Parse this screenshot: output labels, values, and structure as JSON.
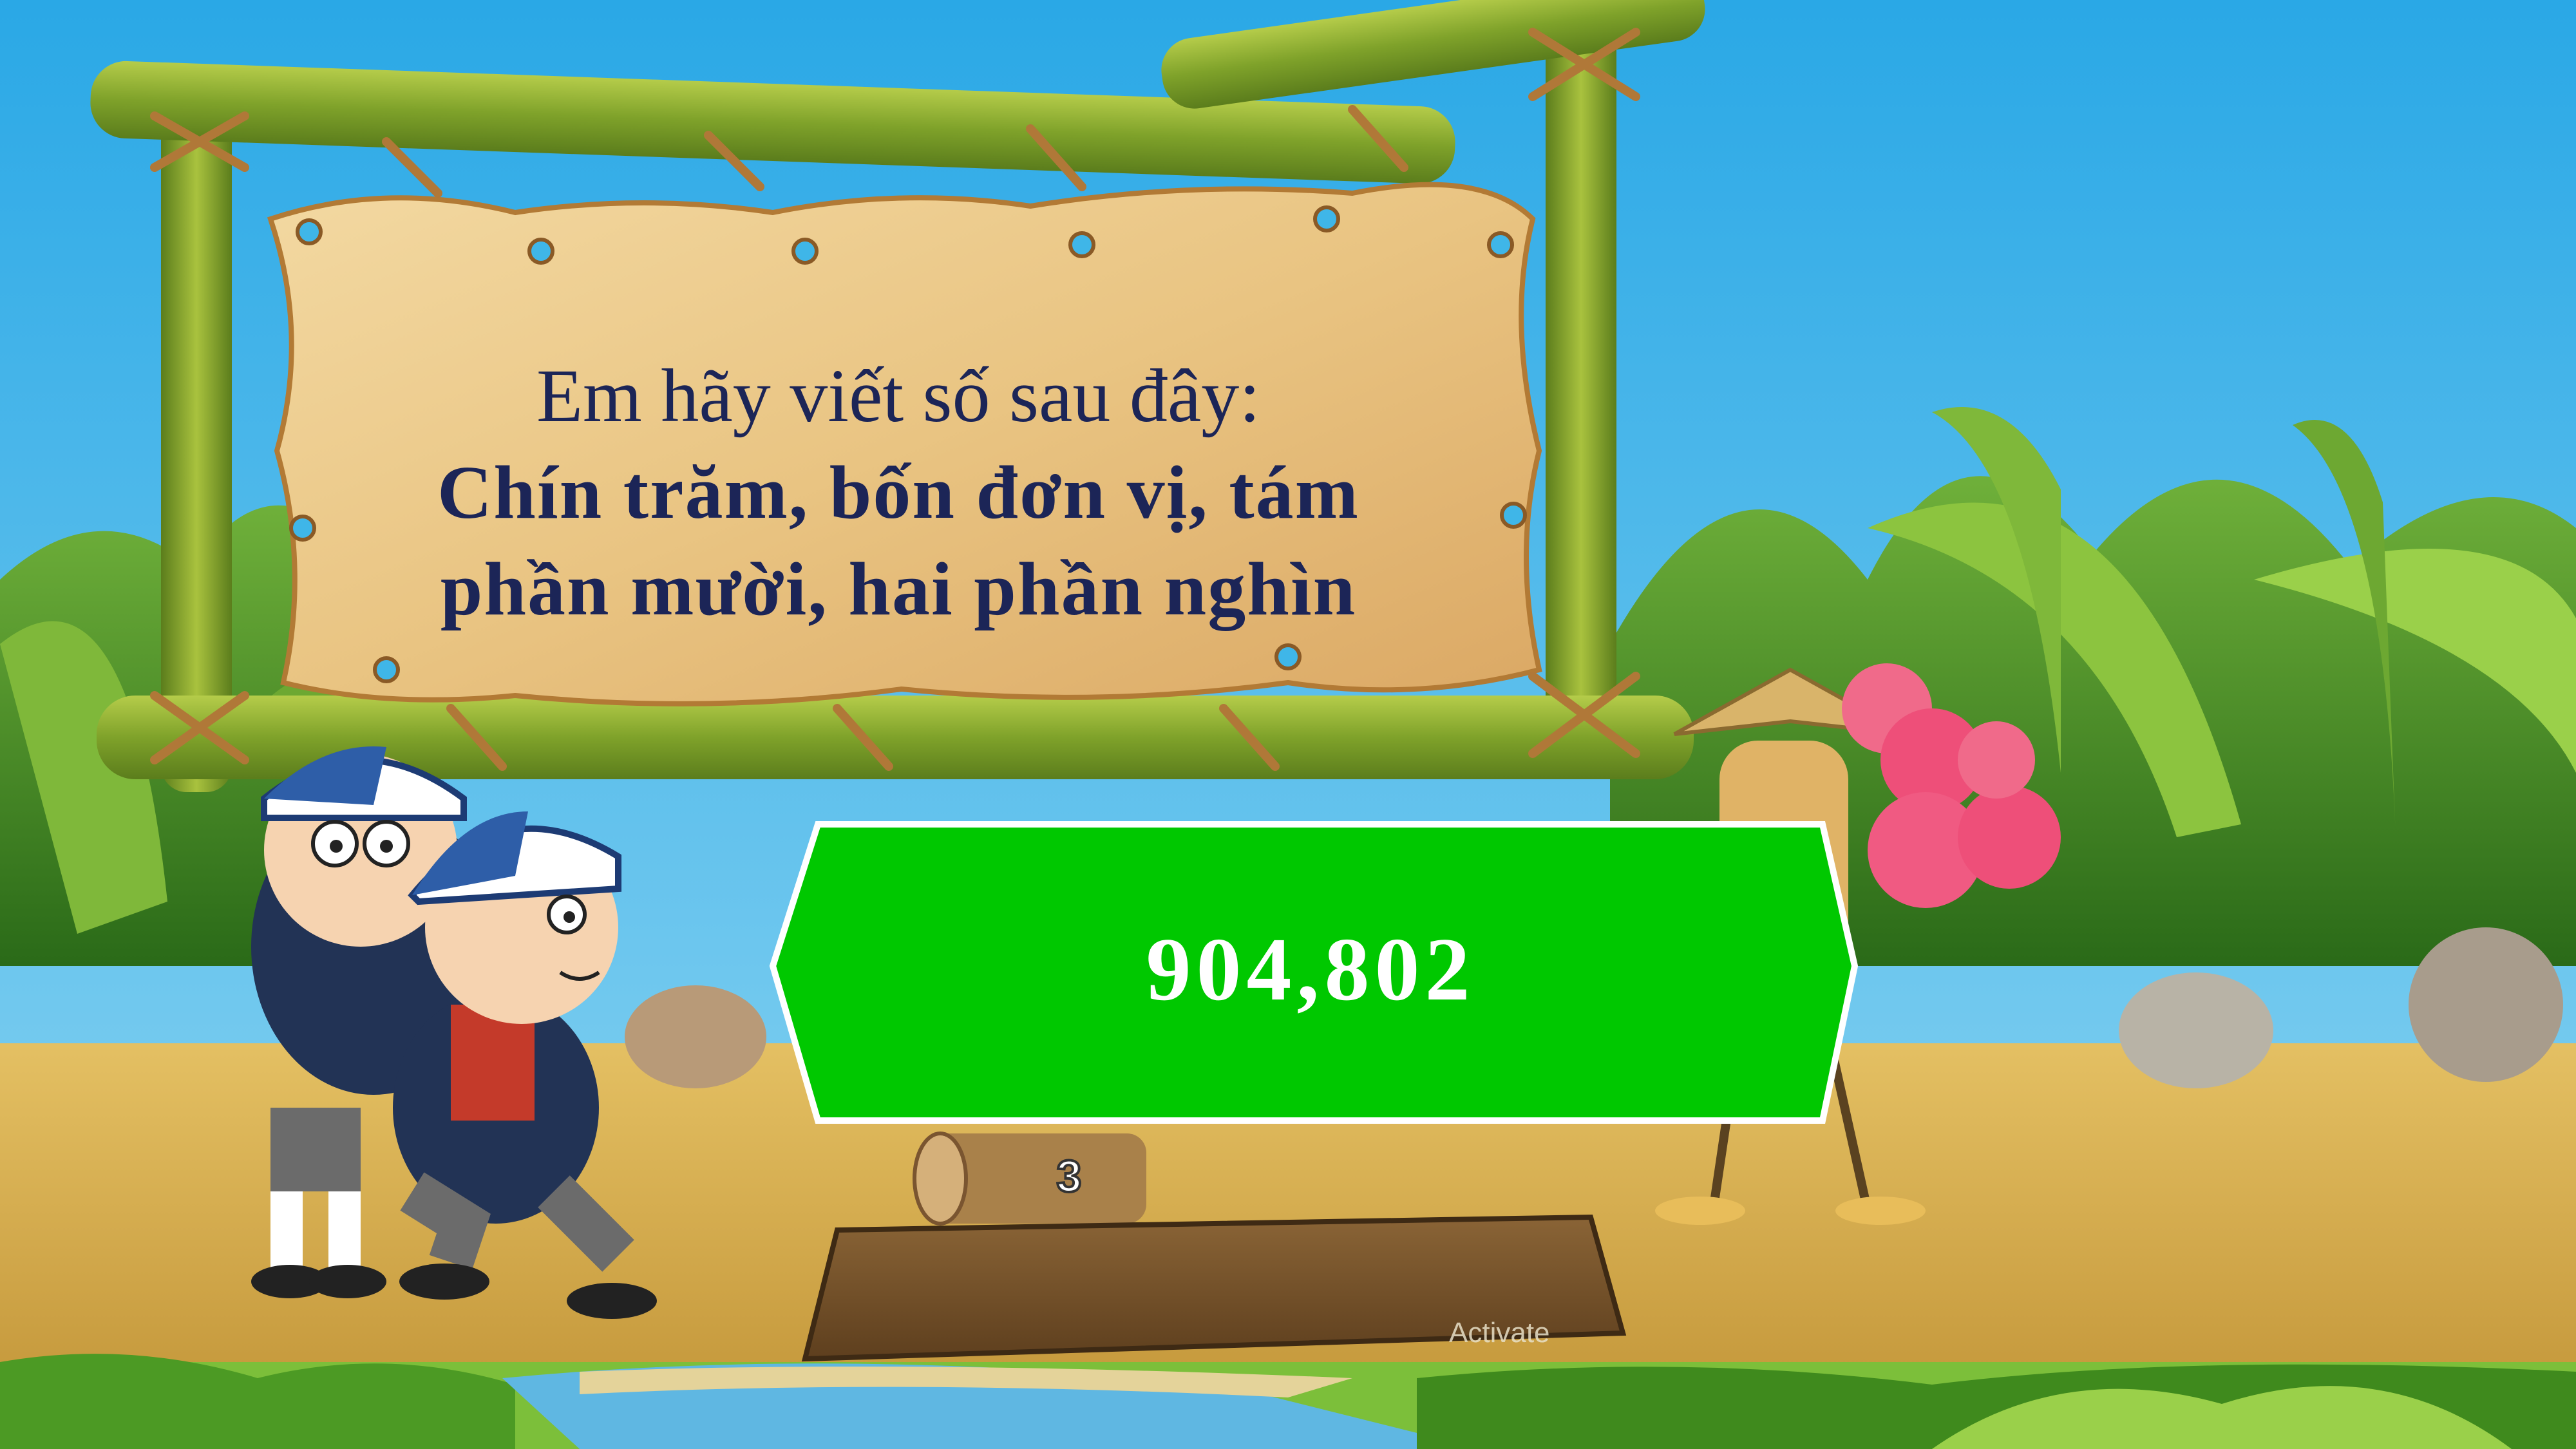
{
  "sign": {
    "question": "Em hãy viết số sau đây:",
    "prompt_line1": "Chín trăm, bốn đơn vị, tám",
    "prompt_line2": "phần mười, hai phần nghìn"
  },
  "answer": {
    "label": "904,802"
  },
  "log": {
    "number": "3"
  },
  "overlay": {
    "activate_text": "Activate"
  },
  "colors": {
    "sky": "#3fb6e8",
    "answer_bg": "#00c800",
    "sign_text": "#1c2557",
    "ground": "#d9b253"
  }
}
